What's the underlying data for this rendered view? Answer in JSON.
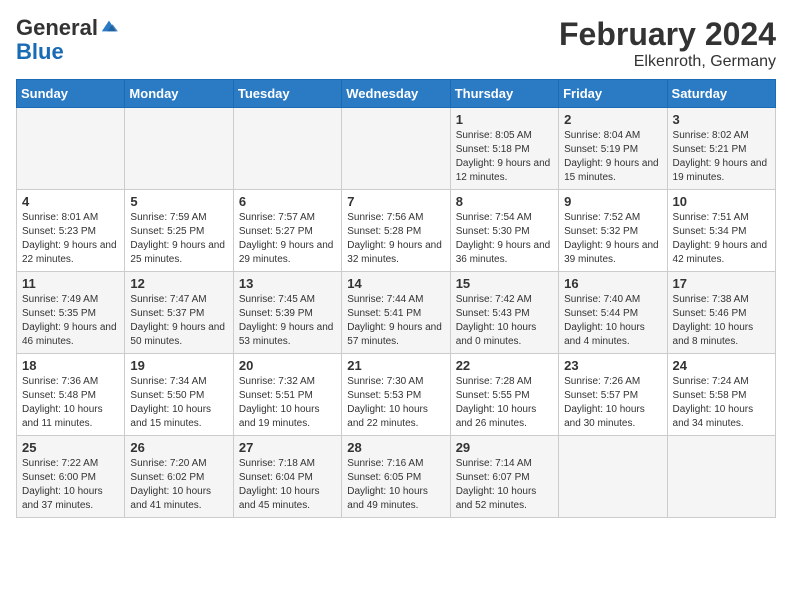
{
  "header": {
    "logo_general": "General",
    "logo_blue": "Blue",
    "month_year": "February 2024",
    "location": "Elkenroth, Germany"
  },
  "days_of_week": [
    "Sunday",
    "Monday",
    "Tuesday",
    "Wednesday",
    "Thursday",
    "Friday",
    "Saturday"
  ],
  "weeks": [
    [
      {
        "day": "",
        "sunrise": "",
        "sunset": "",
        "daylight": ""
      },
      {
        "day": "",
        "sunrise": "",
        "sunset": "",
        "daylight": ""
      },
      {
        "day": "",
        "sunrise": "",
        "sunset": "",
        "daylight": ""
      },
      {
        "day": "",
        "sunrise": "",
        "sunset": "",
        "daylight": ""
      },
      {
        "day": "1",
        "sunrise": "Sunrise: 8:05 AM",
        "sunset": "Sunset: 5:18 PM",
        "daylight": "Daylight: 9 hours and 12 minutes."
      },
      {
        "day": "2",
        "sunrise": "Sunrise: 8:04 AM",
        "sunset": "Sunset: 5:19 PM",
        "daylight": "Daylight: 9 hours and 15 minutes."
      },
      {
        "day": "3",
        "sunrise": "Sunrise: 8:02 AM",
        "sunset": "Sunset: 5:21 PM",
        "daylight": "Daylight: 9 hours and 19 minutes."
      }
    ],
    [
      {
        "day": "4",
        "sunrise": "Sunrise: 8:01 AM",
        "sunset": "Sunset: 5:23 PM",
        "daylight": "Daylight: 9 hours and 22 minutes."
      },
      {
        "day": "5",
        "sunrise": "Sunrise: 7:59 AM",
        "sunset": "Sunset: 5:25 PM",
        "daylight": "Daylight: 9 hours and 25 minutes."
      },
      {
        "day": "6",
        "sunrise": "Sunrise: 7:57 AM",
        "sunset": "Sunset: 5:27 PM",
        "daylight": "Daylight: 9 hours and 29 minutes."
      },
      {
        "day": "7",
        "sunrise": "Sunrise: 7:56 AM",
        "sunset": "Sunset: 5:28 PM",
        "daylight": "Daylight: 9 hours and 32 minutes."
      },
      {
        "day": "8",
        "sunrise": "Sunrise: 7:54 AM",
        "sunset": "Sunset: 5:30 PM",
        "daylight": "Daylight: 9 hours and 36 minutes."
      },
      {
        "day": "9",
        "sunrise": "Sunrise: 7:52 AM",
        "sunset": "Sunset: 5:32 PM",
        "daylight": "Daylight: 9 hours and 39 minutes."
      },
      {
        "day": "10",
        "sunrise": "Sunrise: 7:51 AM",
        "sunset": "Sunset: 5:34 PM",
        "daylight": "Daylight: 9 hours and 42 minutes."
      }
    ],
    [
      {
        "day": "11",
        "sunrise": "Sunrise: 7:49 AM",
        "sunset": "Sunset: 5:35 PM",
        "daylight": "Daylight: 9 hours and 46 minutes."
      },
      {
        "day": "12",
        "sunrise": "Sunrise: 7:47 AM",
        "sunset": "Sunset: 5:37 PM",
        "daylight": "Daylight: 9 hours and 50 minutes."
      },
      {
        "day": "13",
        "sunrise": "Sunrise: 7:45 AM",
        "sunset": "Sunset: 5:39 PM",
        "daylight": "Daylight: 9 hours and 53 minutes."
      },
      {
        "day": "14",
        "sunrise": "Sunrise: 7:44 AM",
        "sunset": "Sunset: 5:41 PM",
        "daylight": "Daylight: 9 hours and 57 minutes."
      },
      {
        "day": "15",
        "sunrise": "Sunrise: 7:42 AM",
        "sunset": "Sunset: 5:43 PM",
        "daylight": "Daylight: 10 hours and 0 minutes."
      },
      {
        "day": "16",
        "sunrise": "Sunrise: 7:40 AM",
        "sunset": "Sunset: 5:44 PM",
        "daylight": "Daylight: 10 hours and 4 minutes."
      },
      {
        "day": "17",
        "sunrise": "Sunrise: 7:38 AM",
        "sunset": "Sunset: 5:46 PM",
        "daylight": "Daylight: 10 hours and 8 minutes."
      }
    ],
    [
      {
        "day": "18",
        "sunrise": "Sunrise: 7:36 AM",
        "sunset": "Sunset: 5:48 PM",
        "daylight": "Daylight: 10 hours and 11 minutes."
      },
      {
        "day": "19",
        "sunrise": "Sunrise: 7:34 AM",
        "sunset": "Sunset: 5:50 PM",
        "daylight": "Daylight: 10 hours and 15 minutes."
      },
      {
        "day": "20",
        "sunrise": "Sunrise: 7:32 AM",
        "sunset": "Sunset: 5:51 PM",
        "daylight": "Daylight: 10 hours and 19 minutes."
      },
      {
        "day": "21",
        "sunrise": "Sunrise: 7:30 AM",
        "sunset": "Sunset: 5:53 PM",
        "daylight": "Daylight: 10 hours and 22 minutes."
      },
      {
        "day": "22",
        "sunrise": "Sunrise: 7:28 AM",
        "sunset": "Sunset: 5:55 PM",
        "daylight": "Daylight: 10 hours and 26 minutes."
      },
      {
        "day": "23",
        "sunrise": "Sunrise: 7:26 AM",
        "sunset": "Sunset: 5:57 PM",
        "daylight": "Daylight: 10 hours and 30 minutes."
      },
      {
        "day": "24",
        "sunrise": "Sunrise: 7:24 AM",
        "sunset": "Sunset: 5:58 PM",
        "daylight": "Daylight: 10 hours and 34 minutes."
      }
    ],
    [
      {
        "day": "25",
        "sunrise": "Sunrise: 7:22 AM",
        "sunset": "Sunset: 6:00 PM",
        "daylight": "Daylight: 10 hours and 37 minutes."
      },
      {
        "day": "26",
        "sunrise": "Sunrise: 7:20 AM",
        "sunset": "Sunset: 6:02 PM",
        "daylight": "Daylight: 10 hours and 41 minutes."
      },
      {
        "day": "27",
        "sunrise": "Sunrise: 7:18 AM",
        "sunset": "Sunset: 6:04 PM",
        "daylight": "Daylight: 10 hours and 45 minutes."
      },
      {
        "day": "28",
        "sunrise": "Sunrise: 7:16 AM",
        "sunset": "Sunset: 6:05 PM",
        "daylight": "Daylight: 10 hours and 49 minutes."
      },
      {
        "day": "29",
        "sunrise": "Sunrise: 7:14 AM",
        "sunset": "Sunset: 6:07 PM",
        "daylight": "Daylight: 10 hours and 52 minutes."
      },
      {
        "day": "",
        "sunrise": "",
        "sunset": "",
        "daylight": ""
      },
      {
        "day": "",
        "sunrise": "",
        "sunset": "",
        "daylight": ""
      }
    ]
  ]
}
